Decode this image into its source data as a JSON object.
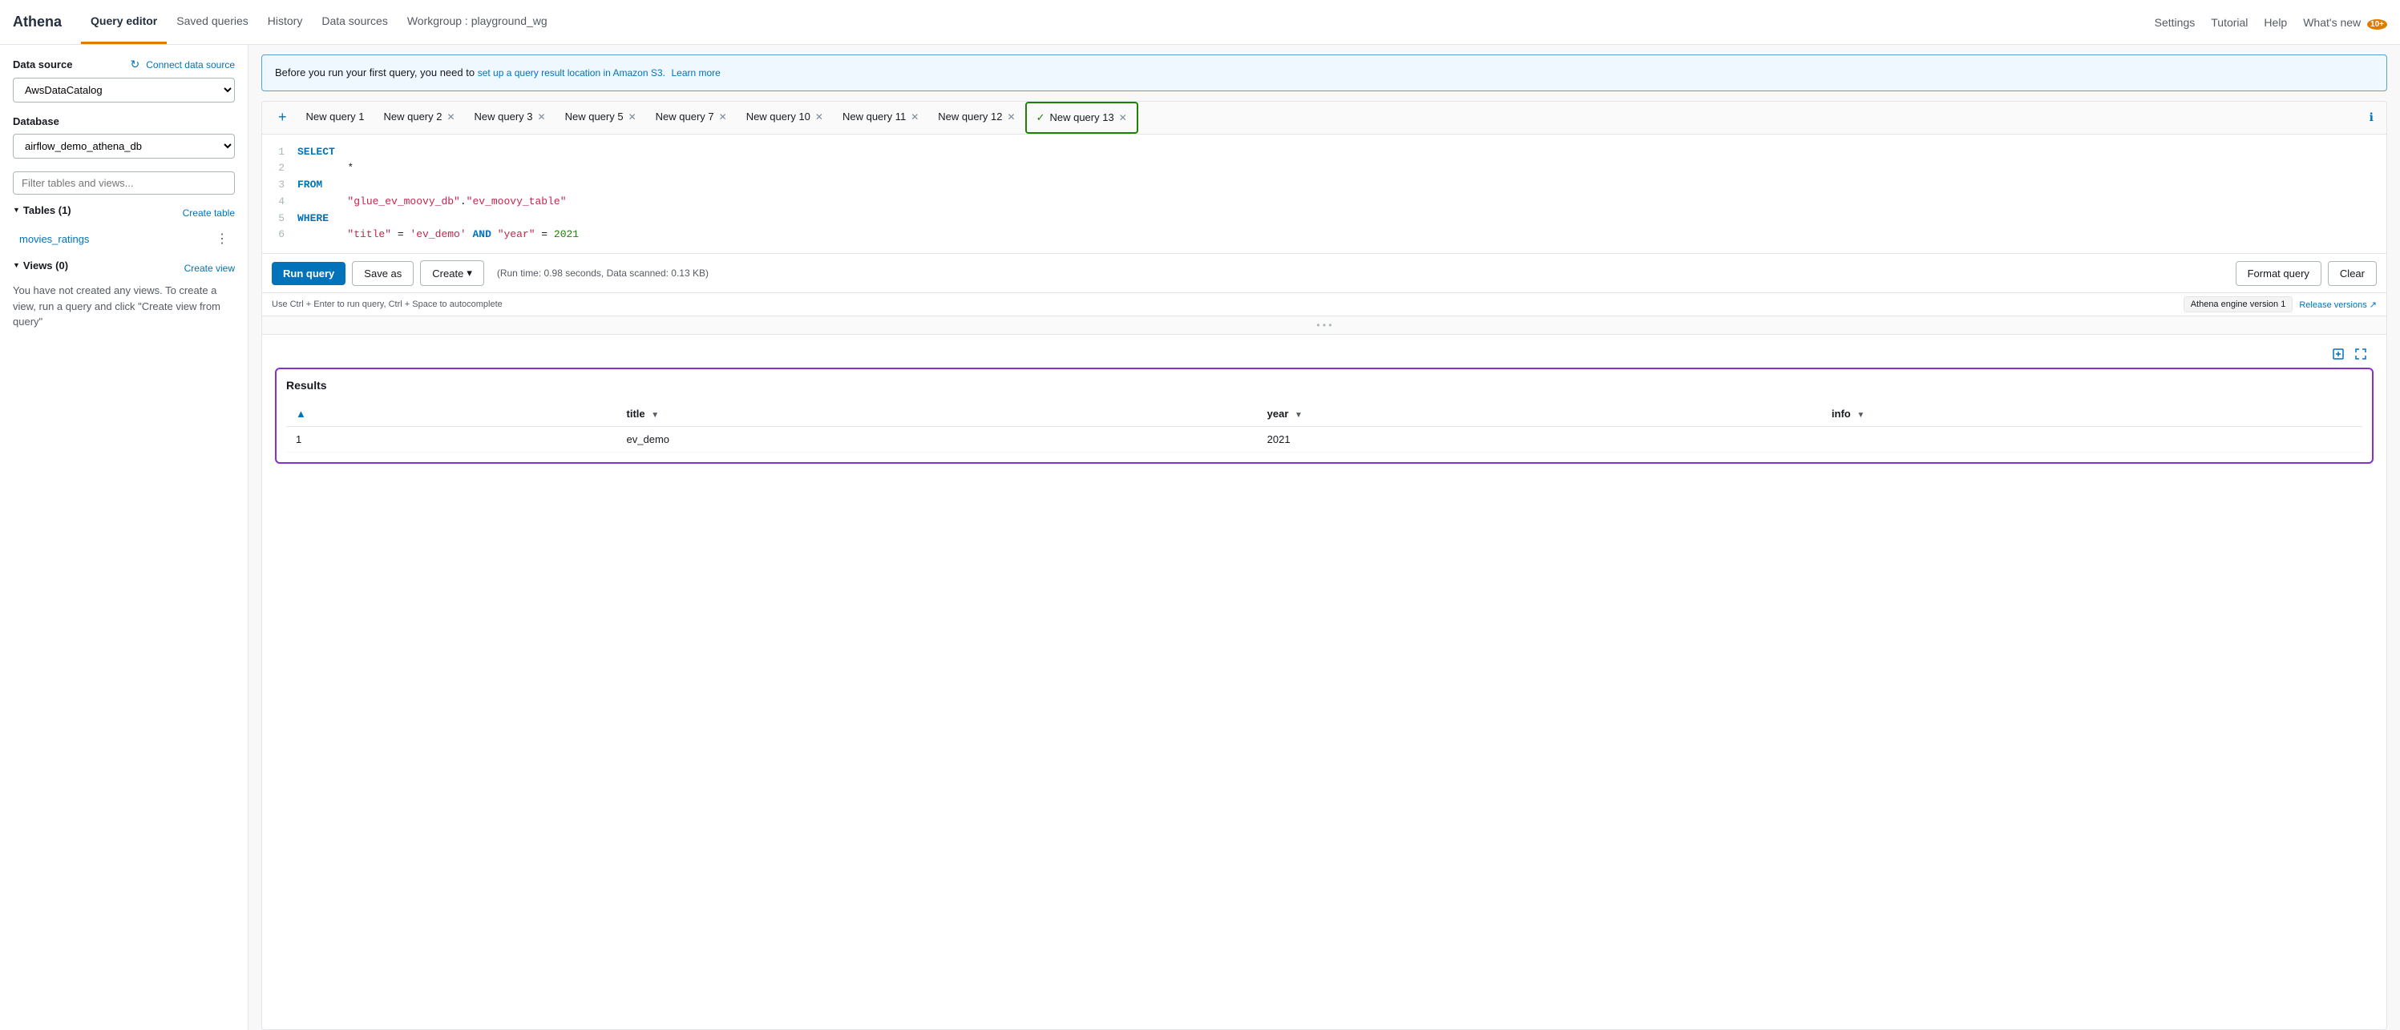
{
  "app": {
    "name": "Athena"
  },
  "topnav": {
    "active_tab": "Query editor",
    "items": [
      "Query editor",
      "Saved queries",
      "History",
      "Data sources",
      "Workgroup : playground_wg"
    ],
    "right_items": [
      "Settings",
      "Tutorial",
      "Help",
      "What's new"
    ],
    "whats_new_badge": "10+"
  },
  "sidebar": {
    "refresh_label": "↻",
    "data_source_label": "Data source",
    "connect_link": "Connect data source",
    "data_source_value": "AwsDataCatalog",
    "database_label": "Database",
    "database_value": "airflow_demo_athena_db",
    "filter_placeholder": "Filter tables and views...",
    "tables_label": "Tables (1)",
    "create_table_link": "Create table",
    "table_items": [
      "movies_ratings"
    ],
    "views_label": "Views (0)",
    "create_view_link": "Create view",
    "views_empty_text": "You have not created any views. To create a view, run a query and click \"Create view from query\""
  },
  "info_banner": {
    "text_before": "Before you run your first query, you need to",
    "link_text": "set up a query result location in Amazon S3.",
    "text_after": "Learn more"
  },
  "tabs": [
    {
      "label": "New query 1",
      "closable": false,
      "active": false,
      "success": false
    },
    {
      "label": "New query 2",
      "closable": true,
      "active": false,
      "success": false
    },
    {
      "label": "New query 3",
      "closable": true,
      "active": false,
      "success": false
    },
    {
      "label": "New query 5",
      "closable": true,
      "active": false,
      "success": false
    },
    {
      "label": "New query 7",
      "closable": true,
      "active": false,
      "success": false
    },
    {
      "label": "New query 10",
      "closable": true,
      "active": false,
      "success": false
    },
    {
      "label": "New query 11",
      "closable": true,
      "active": false,
      "success": false
    },
    {
      "label": "New query 12",
      "closable": true,
      "active": false,
      "success": false
    },
    {
      "label": "New query 13",
      "closable": true,
      "active": true,
      "success": true
    }
  ],
  "editor": {
    "lines": [
      {
        "num": "1",
        "code": "SELECT",
        "parts": [
          {
            "t": "kw",
            "v": "SELECT"
          }
        ]
      },
      {
        "num": "2",
        "code": "    *",
        "parts": [
          {
            "t": "plain",
            "v": "    *"
          }
        ]
      },
      {
        "num": "3",
        "code": "FROM",
        "parts": [
          {
            "t": "kw",
            "v": "FROM"
          }
        ]
      },
      {
        "num": "4",
        "code": "    \"glue_ev_moovy_db\".\"ev_moovy_table\"",
        "parts": [
          {
            "t": "str",
            "v": "    \"glue_ev_moovy_db\""
          },
          {
            "t": "plain",
            "v": "."
          },
          {
            "t": "str",
            "v": "\"ev_moovy_table\""
          }
        ]
      },
      {
        "num": "5",
        "code": "WHERE",
        "parts": [
          {
            "t": "kw",
            "v": "WHERE"
          }
        ]
      },
      {
        "num": "6",
        "code": "    \"title\" = 'ev_demo' AND \"year\" = 2021",
        "parts": [
          {
            "t": "str",
            "v": "    \"title\""
          },
          {
            "t": "plain",
            "v": " = "
          },
          {
            "t": "str",
            "v": "'ev_demo'"
          },
          {
            "t": "plain",
            "v": " "
          },
          {
            "t": "kw",
            "v": "AND"
          },
          {
            "t": "plain",
            "v": " "
          },
          {
            "t": "str",
            "v": "\"year\""
          },
          {
            "t": "plain",
            "v": " = "
          },
          {
            "t": "num",
            "v": "2021"
          }
        ]
      }
    ]
  },
  "action_bar": {
    "run_query_label": "Run query",
    "save_as_label": "Save as",
    "create_label": "Create",
    "run_stats": "(Run time: 0.98 seconds, Data scanned: 0.13 KB)",
    "format_query_label": "Format query",
    "clear_label": "Clear"
  },
  "hint_bar": {
    "hint": "Use Ctrl + Enter to run query, Ctrl + Space to autocomplete",
    "engine_label": "Athena engine version 1",
    "release_link": "Release versions ↗"
  },
  "results": {
    "title": "Results",
    "columns": [
      {
        "label": "",
        "sortable": false
      },
      {
        "label": "title",
        "sortable": true
      },
      {
        "label": "year",
        "sortable": true
      },
      {
        "label": "info",
        "sortable": true
      }
    ],
    "rows": [
      {
        "num": "1",
        "title": "ev_demo",
        "year": "2021",
        "info": ""
      }
    ]
  }
}
